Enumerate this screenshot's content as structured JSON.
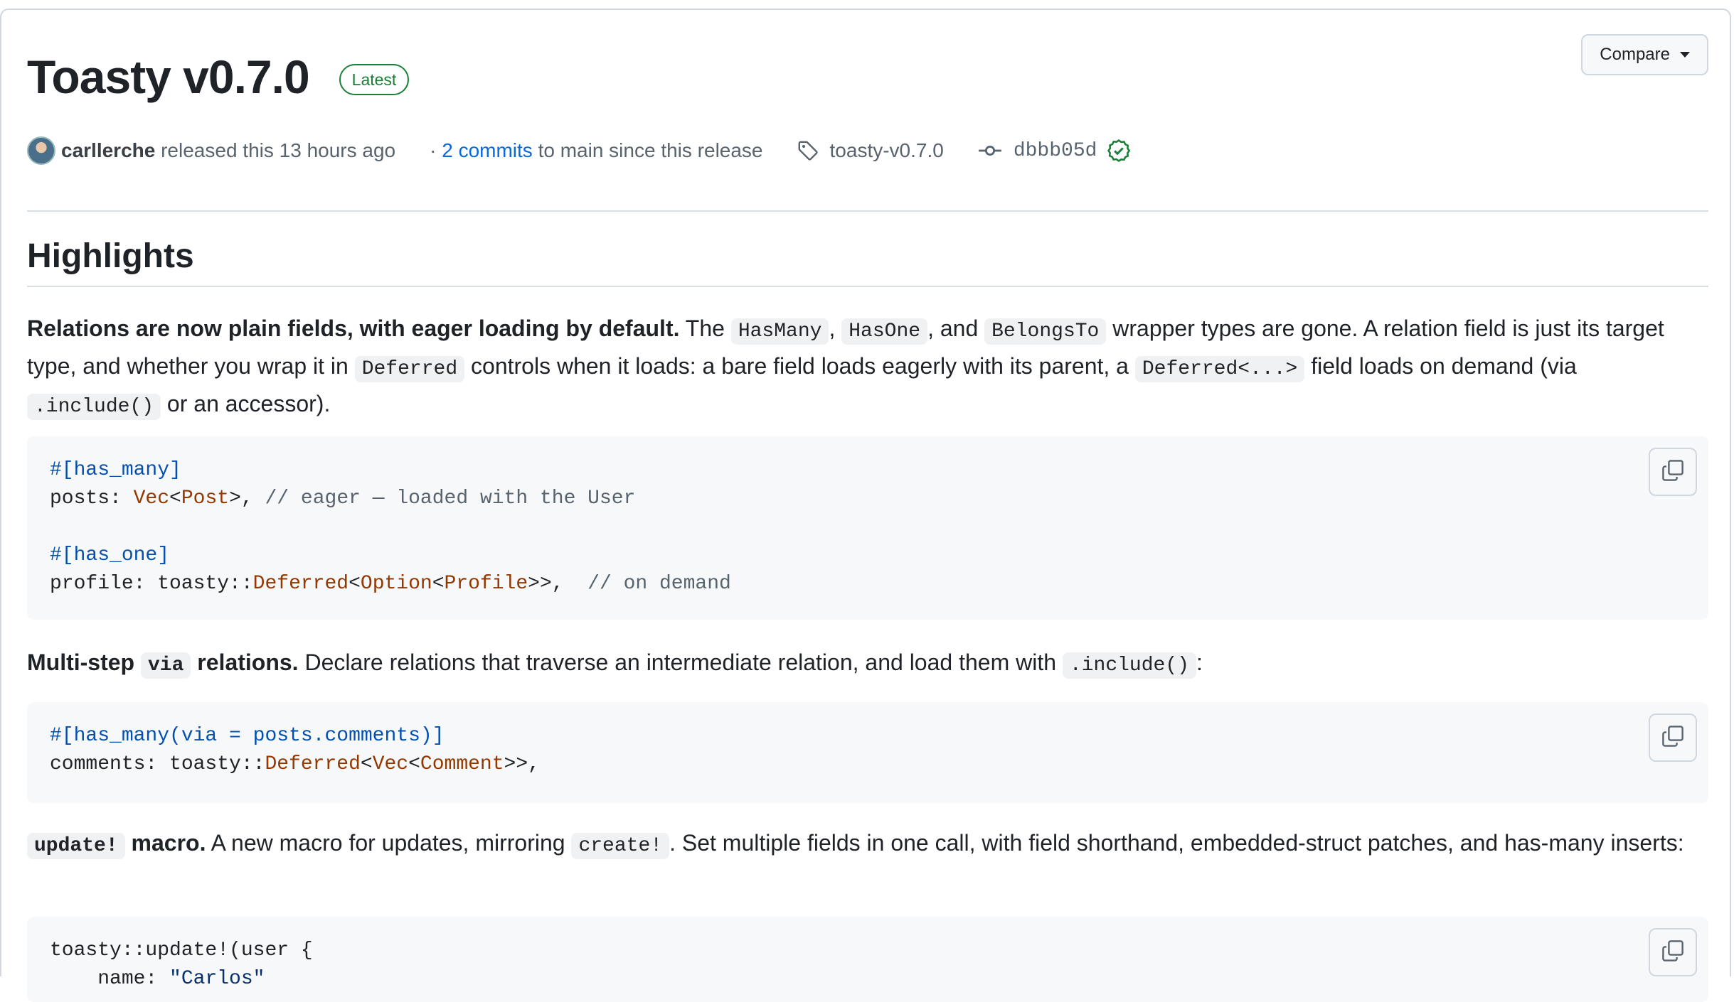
{
  "release": {
    "title": "Toasty v0.7.0",
    "badge": "Latest",
    "compare_label": "Compare",
    "author": "carllerche",
    "released_text": "released this 13 hours ago",
    "commits_link": "2 commits",
    "commits_suffix": "to main since this release",
    "tag": "toasty-v0.7.0",
    "sha": "dbbb05d"
  },
  "body": {
    "heading": "Highlights",
    "p1": {
      "bold": "Relations are now plain fields, with eager loading by default.",
      "t1": " The ",
      "c1": "HasMany",
      "t2": ", ",
      "c2": "HasOne",
      "t3": ", and ",
      "c3": "BelongsTo",
      "t4": " wrapper types are gone. A relation field is just its target type, and whether you wrap it in ",
      "c4": "Deferred",
      "t5": " controls when it loads: a bare field loads eagerly with its parent, a ",
      "c5": "Deferred<...>",
      "t6": " field loads on demand (via ",
      "c6": ".include()",
      "t7": " or an accessor)."
    },
    "code1": {
      "l1": "#[has_many]",
      "l2a": "posts: ",
      "l2b": "Vec",
      "l2c": "<",
      "l2d": "Post",
      "l2e": ">, ",
      "l2f": "// eager — loaded with the User",
      "l4": "#[has_one]",
      "l5a": "profile: toasty::",
      "l5b": "Deferred",
      "l5c": "<",
      "l5d": "Option",
      "l5e": "<",
      "l5f": "Profile",
      "l5g": ">>,  ",
      "l5h": "// on demand"
    },
    "p2": {
      "b1": "Multi-step ",
      "c1": "via",
      "b2": " relations.",
      "t1": " Declare relations that traverse an intermediate relation, and load them with ",
      "c2": ".include()",
      "t2": ":"
    },
    "code2": {
      "l1": "#[has_many(via = posts.comments)]",
      "l2a": "comments: toasty::",
      "l2b": "Deferred",
      "l2c": "<",
      "l2d": "Vec",
      "l2e": "<",
      "l2f": "Comment",
      "l2g": ">>,"
    },
    "p3": {
      "c1": "update!",
      "b1": " macro.",
      "t1": " A new macro for updates, mirroring ",
      "c2": "create!",
      "t2": ". Set multiple fields in one call, with field shorthand, embedded-struct patches, and has-many inserts:"
    },
    "code3": {
      "l1": "toasty::update!(user {",
      "l2a": "    name: ",
      "l2b": "\"Carlos\""
    }
  },
  "icons": {
    "tag": "tag-icon",
    "commit": "git-commit-icon",
    "verified": "verified-check-icon",
    "copy": "copy-icon"
  }
}
